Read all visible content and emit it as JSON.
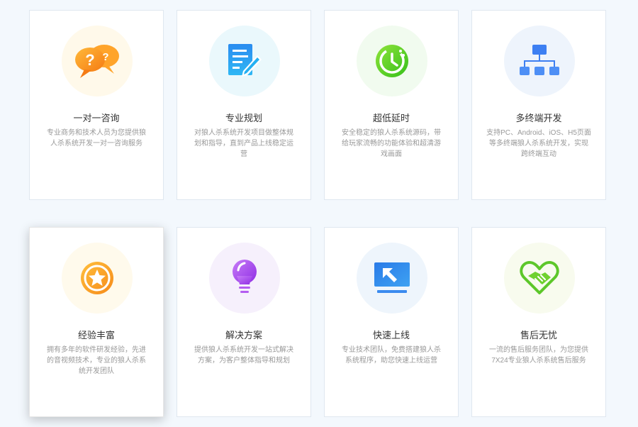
{
  "cards": [
    {
      "title": "一对一咨询",
      "desc": "专业商务和技术人员为您提供狼人杀系统开发一对一咨询服务",
      "bg": "#fff9ea"
    },
    {
      "title": "专业规划",
      "desc": "对狼人杀系统开发项目做整体规划和指导，直到产品上线稳定运营",
      "bg": "#eaf8fc"
    },
    {
      "title": "超低延时",
      "desc": "安全稳定的狼人杀系统源码，带给玩家流畅的功能体验和超清游戏画面",
      "bg": "#f1fbef"
    },
    {
      "title": "多终端开发",
      "desc": "支持PC、Android、iOS、H5页面等多终端狼人杀系统开发，实现跨终端互动",
      "bg": "#eef4fc"
    },
    {
      "title": "经验丰富",
      "desc": "拥有多年的软件研发经验，先进的音视频技术，专业的狼人杀系统开发团队",
      "bg": "#fffaec"
    },
    {
      "title": "解决方案",
      "desc": "提供狼人杀系统开发一站式解决方案，为客户整体指导和规划",
      "bg": "#f6f0fc"
    },
    {
      "title": "快速上线",
      "desc": "专业技术团队，免费搭建狼人杀系统程序，助您快速上线运营",
      "bg": "#eef5fc"
    },
    {
      "title": "售后无忧",
      "desc": "一流的售后服务团队，为您提供7X24专业狼人杀系统售后服务",
      "bg": "#f8fbee"
    }
  ],
  "icons": [
    "chat-bubbles-question-icon",
    "document-pencil-icon",
    "clock-icon",
    "hierarchy-network-icon",
    "star-badge-icon",
    "lightbulb-icon",
    "monitor-arrow-icon",
    "heart-handshake-icon"
  ]
}
